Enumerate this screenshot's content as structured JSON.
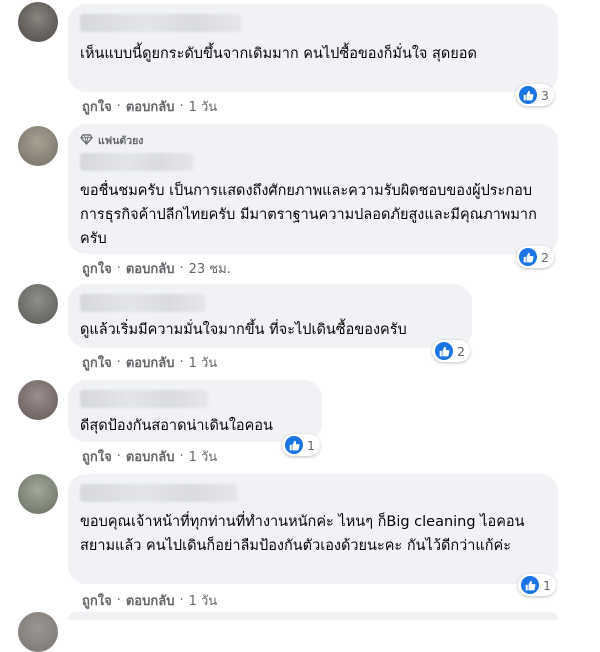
{
  "comments": [
    {
      "text": "เห็นแบบนี้ดูยกระดับขึ้นจากเดิมมาก คนไปซื้อของก็มั่นใจ สุดยอด",
      "actions": {
        "like": "ถูกใจ",
        "reply": "ตอบกลับ",
        "time": "1 วัน"
      },
      "reaction_count": "3"
    },
    {
      "badge": "แฟนตัวยง",
      "text": "ขอชื่นชมครับ เป็นการแสดงถึงศักยภาพและความรับผิดชอบของผู้ประกอบการธุรกิจค้าปลีกไทยครับ มีมาตราฐานความปลอดภัยสูงและมีคุณภาพมากครับ",
      "actions": {
        "like": "ถูกใจ",
        "reply": "ตอบกลับ",
        "time": "23 ชม."
      },
      "reaction_count": "2"
    },
    {
      "text": "ดูแล้วเริ่มมีความมั่นใจมากขึ้น ที่จะไปเดินซื้อของครับ",
      "actions": {
        "like": "ถูกใจ",
        "reply": "ตอบกลับ",
        "time": "1 วัน"
      },
      "reaction_count": "2"
    },
    {
      "text": "ดีสุดป้องกันสอาดน่าเดินใอคอน",
      "actions": {
        "like": "ถูกใจ",
        "reply": "ตอบกลับ",
        "time": "1 วัน"
      },
      "reaction_count": "1"
    },
    {
      "text": "ขอบคุณเจ้าหน้าที่ทุกท่านที่ทำงานหนักค่ะ ไหนๆ ก็Big cleaning ไอคอนสยามแล้ว คนไปเดินก็อย่าลืมป้องกันตัวเองด้วยนะคะ กันไว้ดีกว่าแก้ค่ะ",
      "actions": {
        "like": "ถูกใจ",
        "reply": "ตอบกลับ",
        "time": "1 วัน"
      },
      "reaction_count": "1"
    }
  ],
  "colors": {
    "bubble": "#f0f2f5",
    "like_blue": "#1b74e4",
    "meta_gray": "#65676b"
  },
  "icons": {
    "reaction": "like-thumb-icon",
    "badge": "diamond-icon"
  }
}
